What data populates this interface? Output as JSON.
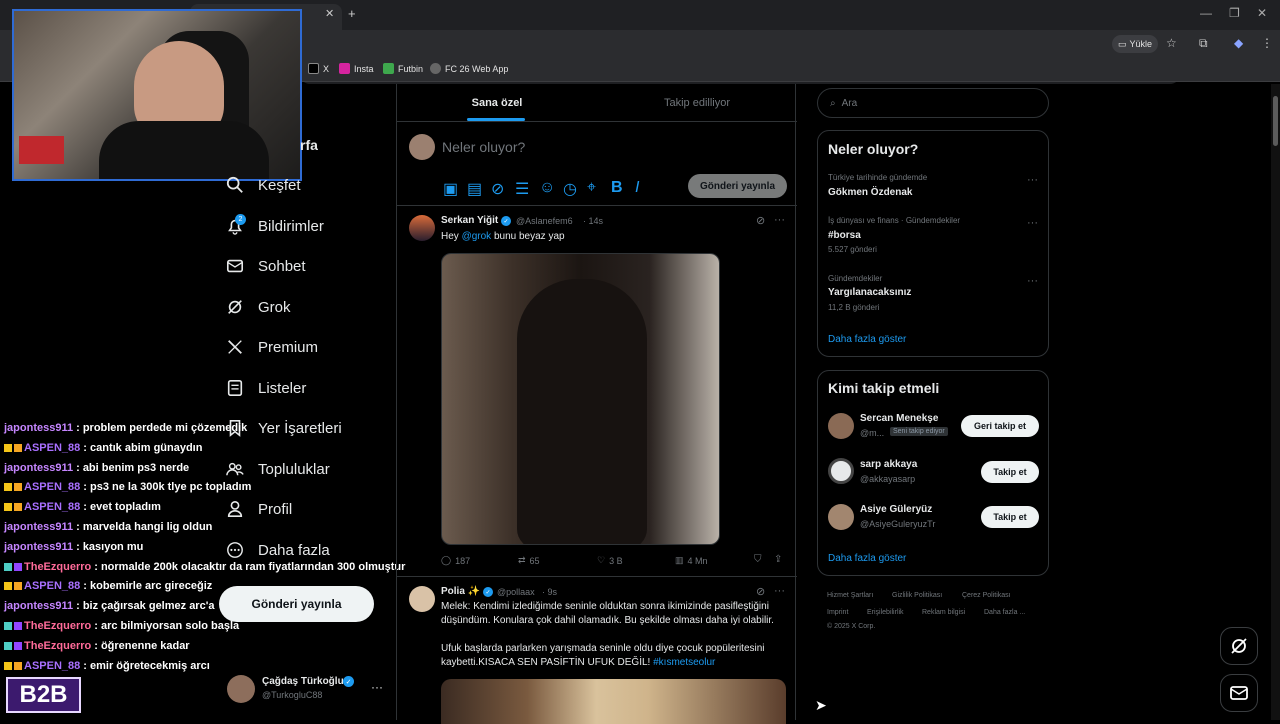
{
  "browser": {
    "upload_label": "Yükle",
    "bookmarks": [
      {
        "label": "X",
        "icon": "x-icon"
      },
      {
        "label": "Insta",
        "icon": "instagram-icon"
      },
      {
        "label": "Futbin",
        "icon": "futbin-icon"
      },
      {
        "label": "FC 26 Web App",
        "icon": "globe-icon"
      }
    ]
  },
  "nav": {
    "partial_title": "rfa",
    "items": [
      {
        "label": "Keşfet",
        "icon": "search-icon"
      },
      {
        "label": "Bildirimler",
        "icon": "bell-icon",
        "badge": "2"
      },
      {
        "label": "Sohbet",
        "icon": "mail-icon"
      },
      {
        "label": "Grok",
        "icon": "grok-icon"
      },
      {
        "label": "Premium",
        "icon": "x-logo-icon"
      },
      {
        "label": "Listeler",
        "icon": "list-icon"
      },
      {
        "label": "Yer İşaretleri",
        "icon": "bookmark-icon"
      },
      {
        "label": "Topluluklar",
        "icon": "communities-icon"
      },
      {
        "label": "Profil",
        "icon": "profile-icon"
      },
      {
        "label": "Daha fazla",
        "icon": "more-icon"
      }
    ],
    "post_button": "Gönderi yayınla",
    "account": {
      "name": "Çağdaş Türkoğlu",
      "handle": "@TurkogluC88"
    }
  },
  "chat": [
    {
      "user": "japontess911",
      "color": "#c586ff",
      "msg": ": problem perdede mi çözemedik",
      "badges": false
    },
    {
      "user": "ASPEN_88",
      "color": "#a970ff",
      "msg": ": cantık abim günaydın",
      "badges": true
    },
    {
      "user": "japontess911",
      "color": "#c586ff",
      "msg": ": abi benim ps3 nerde",
      "badges": false
    },
    {
      "user": "ASPEN_88",
      "color": "#a970ff",
      "msg": ": ps3 ne la 300k tlye pc topladım",
      "badges": true
    },
    {
      "user": "ASPEN_88",
      "color": "#a970ff",
      "msg": ": evet topladım",
      "badges": true
    },
    {
      "user": "japontess911",
      "color": "#c586ff",
      "msg": ": marvelda hangi lig oldun",
      "badges": false
    },
    {
      "user": "japontess911",
      "color": "#c586ff",
      "msg": ": kasıyon mu",
      "badges": false
    },
    {
      "user": "TheEzquerro",
      "color": "#ff6b9a",
      "msg": ": normalde 200k olacaktır da ram fiyatlarından 300 olmuştur",
      "badges": true
    },
    {
      "user": "ASPEN_88",
      "color": "#a970ff",
      "msg": ": kobemirle arc gireceğiz",
      "badges": true
    },
    {
      "user": "japontess911",
      "color": "#c586ff",
      "msg": ": biz çağırsak gelmez arc'a",
      "badges": false
    },
    {
      "user": "TheEzquerro",
      "color": "#ff6b9a",
      "msg": ": arc bilmiyorsan solo başla",
      "badges": true
    },
    {
      "user": "TheEzquerro",
      "color": "#ff6b9a",
      "msg": ": öğrenenne kadar",
      "badges": true
    },
    {
      "user": "ASPEN_88",
      "color": "#a970ff",
      "msg": ": emir öğretecekmiş arcı",
      "badges": true
    }
  ],
  "stream_logo": "B2B",
  "feed": {
    "tabs": [
      "Sana özel",
      "Takip edilliyor"
    ],
    "active_tab": 0,
    "compose_placeholder": "Neler oluyor?",
    "compose_button": "Gönderi yayınla",
    "tweets": [
      {
        "name": "Serkan Yiğit",
        "handle": "@Aslanefem6",
        "time": "· 14s",
        "text_prefix": "Hey ",
        "mention": "@grok",
        "text_suffix": " bunu beyaz yap",
        "stats": {
          "replies": "187",
          "retweets": "65",
          "likes": "3 B",
          "views": "4 Mn"
        }
      },
      {
        "name": "Polia ✨",
        "handle": "@pollaax",
        "time": "· 9s",
        "line1": "Melek: Kendimi izlediğimde seninle olduktan sonra ikimizinde pasifleştiğini",
        "line2": "düşündüm. Konulara çok dahil olamadık. Bu şekilde olması daha iyi olabilir.",
        "line3": "Ufuk başlarda parlarken yarışmada seninle oldu diye çocuk popüleritesini",
        "line4": "kaybetti.KISACA SEN PASİFTİN UFUK DEĞİL!",
        "hashtag": " #kısmetseolur"
      }
    ]
  },
  "right": {
    "search_placeholder": "Ara",
    "trends_title": "Neler oluyor?",
    "trends": [
      {
        "meta": "Türkiye tarihinde gündemde",
        "title": "Gökmen Özdenak",
        "count": ""
      },
      {
        "meta": "İş dünyası ve finans · Gündemdekiler",
        "title": "#borsa",
        "count": "5.527 gönderi"
      },
      {
        "meta": "Gündemdekiler",
        "title": "Yargılanacaksınız",
        "count": "11,2 B gönderi"
      }
    ],
    "show_more": "Daha fazla göster",
    "who_title": "Kimi takip etmeli",
    "who": [
      {
        "name": "Sercan Menekşe",
        "handle": "@m...",
        "tag": "Seni takip ediyor",
        "button": "Geri takip et"
      },
      {
        "name": "sarp akkaya",
        "handle": "@akkayasarp",
        "tag": "",
        "button": "Takip et"
      },
      {
        "name": "Asiye Güleryüz",
        "handle": "@AsiyeGuleryuzTr",
        "tag": "",
        "button": "Takip et"
      }
    ],
    "who_more": "Daha fazla göster",
    "footer": [
      "Hizmet Şartları",
      "Gizlilik Politikası",
      "Çerez Politikası",
      "Imprint",
      "Erişilebilirlik",
      "Reklam bilgisi",
      "Daha fazla ...",
      "© 2025 X Corp."
    ]
  }
}
